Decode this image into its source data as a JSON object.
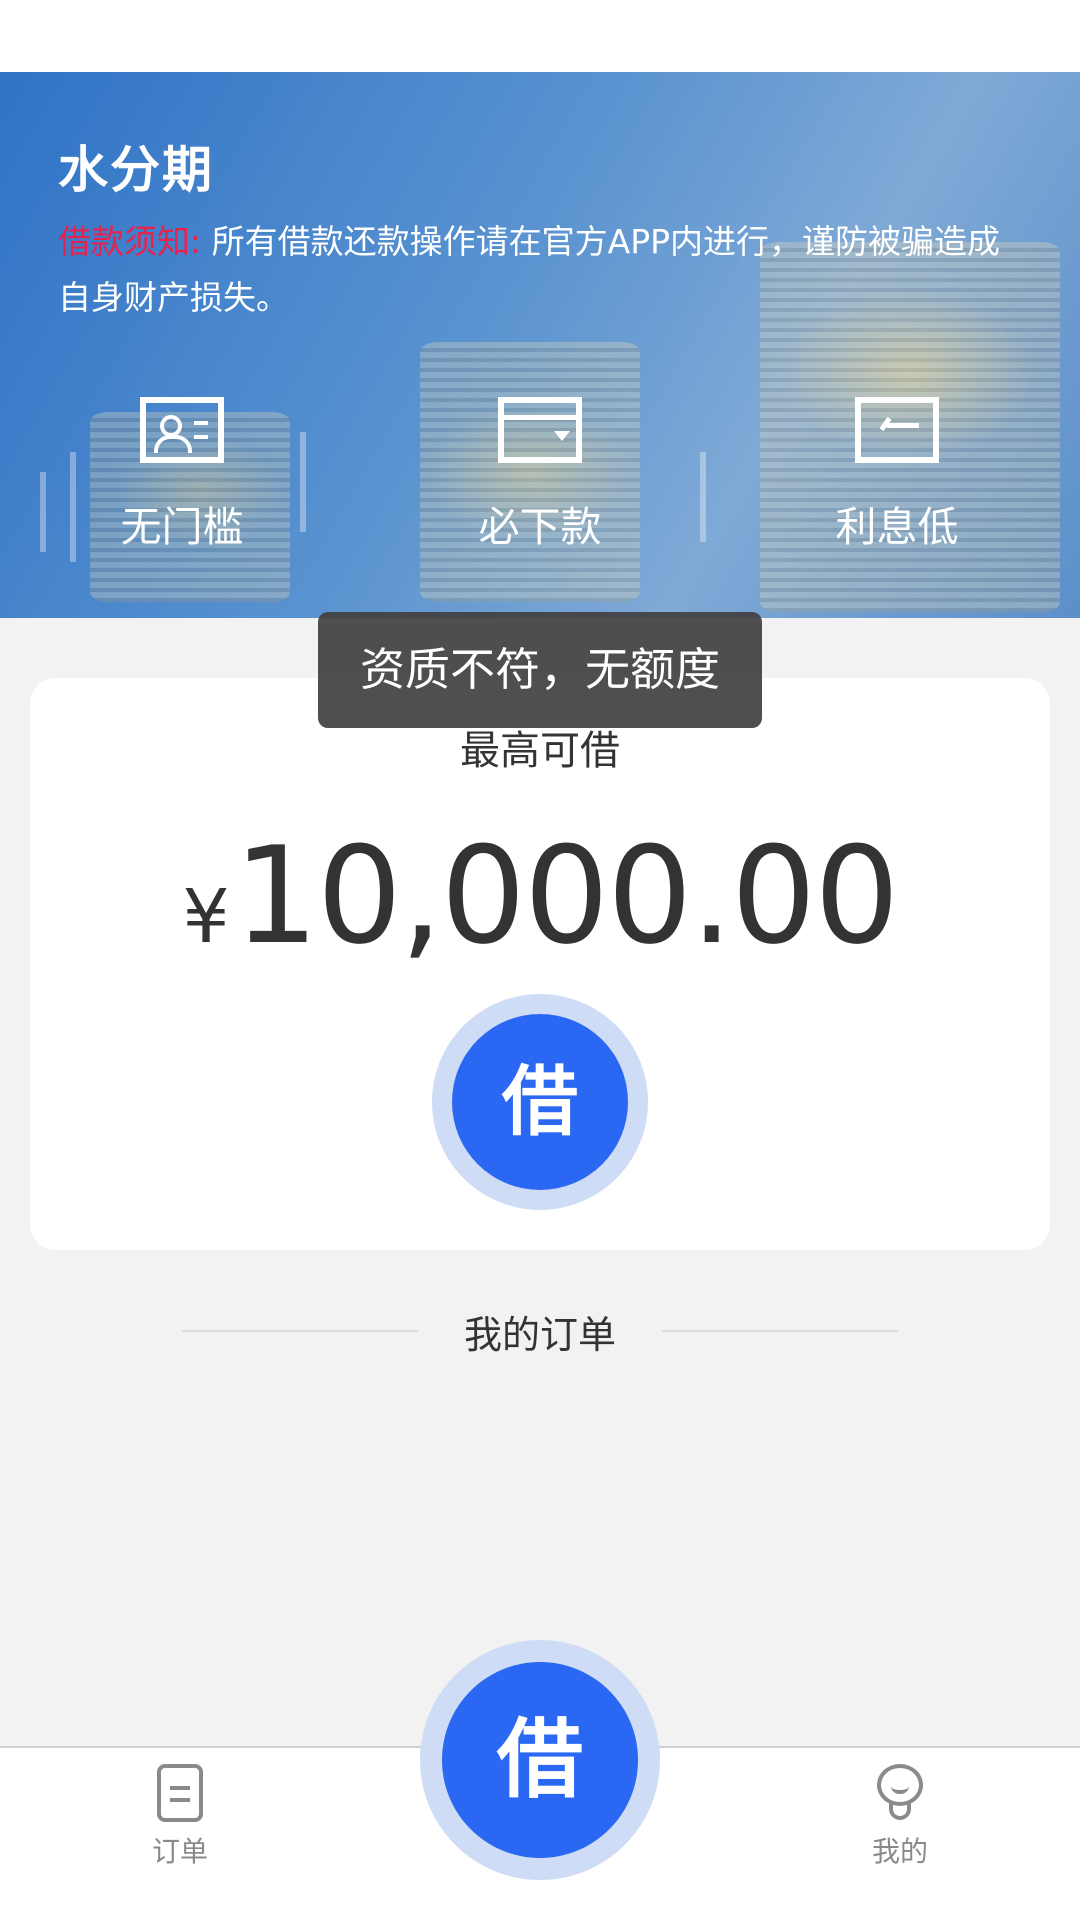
{
  "header": {
    "app_title": "水分期",
    "notice_label": "借款须知:",
    "notice_text": " 所有借款还款操作请在官方APP内进行，谨防被骗造成自身财产损失。"
  },
  "features": [
    {
      "label": "无门槛",
      "icon": "id-card-icon"
    },
    {
      "label": "必下款",
      "icon": "card-icon"
    },
    {
      "label": "利息低",
      "icon": "rate-icon"
    }
  ],
  "toast": {
    "text": "资质不符，无额度"
  },
  "loan_card": {
    "max_label": "最高可借",
    "currency": "¥",
    "amount": "10,000.00",
    "borrow_button": "借"
  },
  "orders": {
    "title": "我的订单"
  },
  "tab_bar": {
    "orders_label": "订单",
    "center_button": "借",
    "mine_label": "我的"
  },
  "colors": {
    "accent": "#2a67f2",
    "notice_label": "#e8224d",
    "background": "#f2f2f2"
  }
}
